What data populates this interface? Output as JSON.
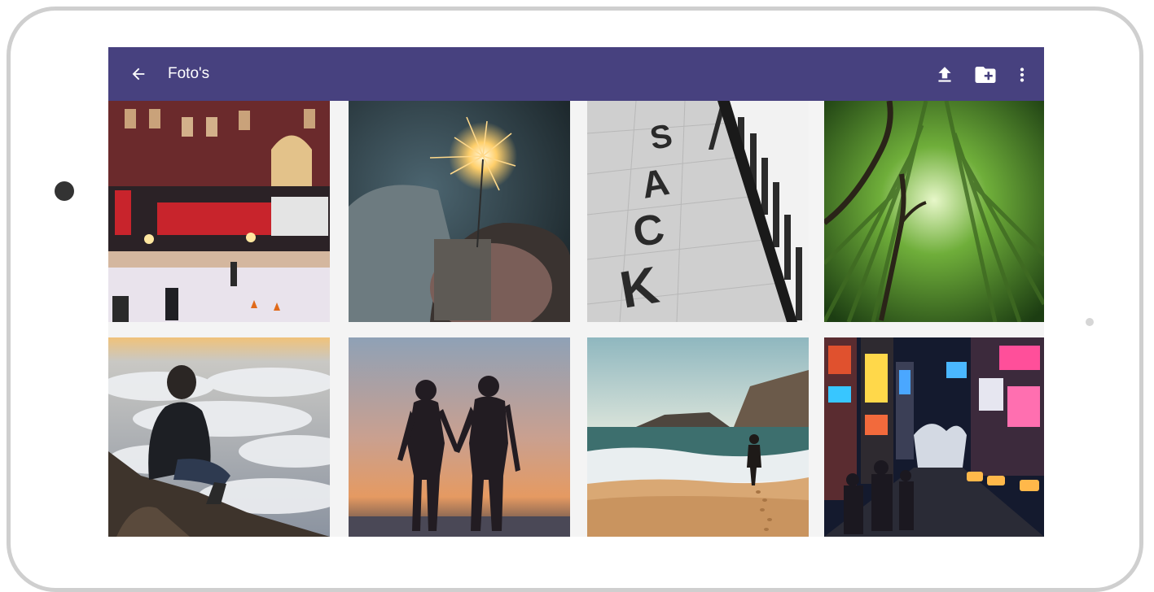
{
  "appbar": {
    "title": "Foto's",
    "background": "#47417f",
    "icons": {
      "back": "arrow-back-icon",
      "upload": "upload-icon",
      "new_folder": "create-folder-icon",
      "more": "more-vertical-icon"
    }
  },
  "photos": [
    {
      "subject": "amsterdam-ice-rink"
    },
    {
      "subject": "sparkler-hand"
    },
    {
      "subject": "stack-letters-piano"
    },
    {
      "subject": "bamboo-forest"
    },
    {
      "subject": "man-above-clouds"
    },
    {
      "subject": "couple-silhouette-sunset"
    },
    {
      "subject": "beach-walker"
    },
    {
      "subject": "city-night-street"
    }
  ]
}
